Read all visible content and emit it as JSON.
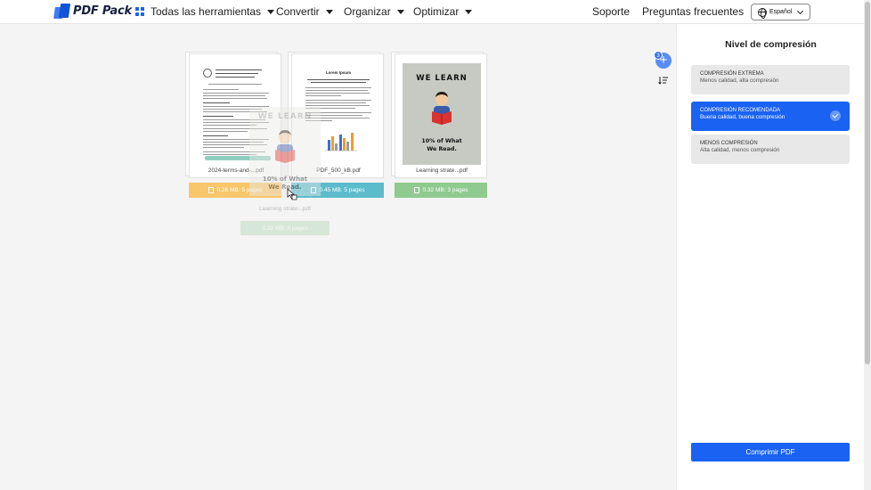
{
  "header": {
    "logo_text": "PDF Pack",
    "nav": [
      {
        "label": "Todas las herramientas"
      },
      {
        "label": "Convertir"
      },
      {
        "label": "Organizar"
      },
      {
        "label": "Optimizar"
      }
    ],
    "support_label": "Soporte",
    "faq_label": "Preguntas frecuentes",
    "language": "Español"
  },
  "files": [
    {
      "name": "2024-terms-and-...pdf",
      "info": "0.26 MB: 5 pages",
      "tag_color": "#f8c66b"
    },
    {
      "name": "PDF_500_kB.pdf",
      "info": "0.45 MB: 5 pages",
      "tag_color": "#5cbccc"
    },
    {
      "name": "Learning strate...pdf",
      "info": "0.32 MB: 3 pages",
      "tag_color": "#8fca8f"
    }
  ],
  "doc_preview": {
    "lorem_title": "Lorem Ipsum"
  },
  "poster": {
    "heading": "WE LEARN",
    "line1": "10% of What",
    "line2": "We Read."
  },
  "drag_ghost": {
    "heading": "WE LEARN",
    "line1": "10% of What",
    "line2": "We Read.",
    "name": "Learning strate...pdf",
    "info": "0.32 MB: 3 pages"
  },
  "file_count_badge": "3",
  "panel": {
    "title": "Nivel de compresión",
    "options": [
      {
        "title": "COMPRESIÓN EXTREMA",
        "subtitle": "Menos calidad, alta compresión",
        "selected": false
      },
      {
        "title": "COMPRESIÓN RECOMENDADA",
        "subtitle": "Buena calidad, buena compresión",
        "selected": true
      },
      {
        "title": "MENOS COMPRESIÓN",
        "subtitle": "Alta calidad, menos compresión",
        "selected": false
      }
    ],
    "button_label": "Comprimir PDF"
  },
  "colors": {
    "accent": "#1a62f1",
    "tag_yellow": "#f8c66b",
    "tag_teal": "#5cbccc",
    "tag_green": "#8fca8f"
  },
  "icons": [
    "app-logo-icon",
    "grid-icon",
    "caret-down-icon",
    "globe-icon",
    "chevron-down-icon",
    "trash-icon",
    "plus-icon",
    "sort-icon",
    "check-icon",
    "cursor-icon"
  ]
}
